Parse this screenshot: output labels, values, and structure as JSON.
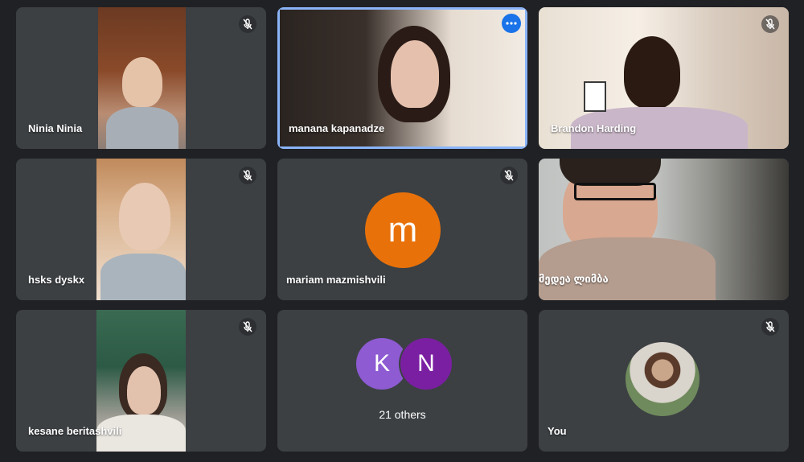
{
  "participants": [
    {
      "name": "Ninia Ninia",
      "muted": true
    },
    {
      "name": "manana kapanadze",
      "muted": false,
      "active": true
    },
    {
      "name": "Brandon Harding",
      "muted": true
    },
    {
      "name": "hsks dyskx",
      "muted": true
    },
    {
      "name": "mariam mazmishvili",
      "muted": true,
      "avatar_letter": "m",
      "avatar_color": "#e8710a"
    },
    {
      "name": "მედეა ლიმბა",
      "muted": false
    },
    {
      "name": "kesane beritashvili",
      "muted": true
    },
    {
      "name": "You",
      "muted": true
    }
  ],
  "others_tile": {
    "label": "21 others",
    "avatars": [
      {
        "letter": "K",
        "color": "#8e5bd2"
      },
      {
        "letter": "N",
        "color": "#7b1fa2"
      }
    ]
  },
  "icons": {
    "mic": "mic-off-icon",
    "more": "more-options-icon"
  },
  "colors": {
    "background": "#202124",
    "tile": "#3c4043",
    "active_border": "#8ab4f8",
    "more_button": "#1a73e8"
  }
}
